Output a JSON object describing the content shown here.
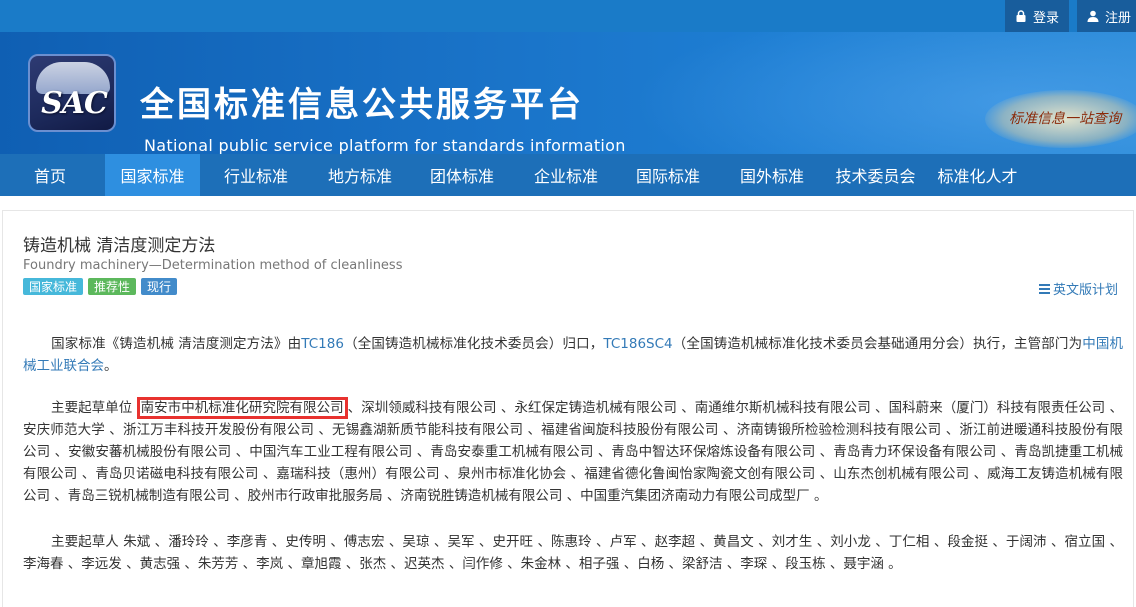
{
  "topbar": {
    "login_label": "登录",
    "register_label": "注册"
  },
  "header": {
    "logo_text": "SAC",
    "title_cn": "全国标准信息公共服务平台",
    "title_en": "National public service platform  for standards information",
    "slogan": "标准信息一站查询"
  },
  "nav": {
    "items": [
      "首页",
      "国家标准",
      "行业标准",
      "地方标准",
      "团体标准",
      "企业标准",
      "国际标准",
      "国外标准",
      "技术委员会",
      "标准化人才"
    ],
    "active": "国家标准"
  },
  "standard": {
    "title": "铸造机械 清洁度测定方法",
    "title_en": "Foundry machinery—Determination method of cleanliness",
    "badges": [
      "国家标准",
      "推荐性",
      "现行"
    ],
    "english_plan_label": "英文版计划"
  },
  "desc": {
    "prefix": "国家标准《铸造机械 清洁度测定方法》由",
    "tc_code": "TC186",
    "tc_name": "（全国铸造机械标准化技术委员会）归口，",
    "sc_code": "TC186SC4",
    "sc_name": "（全国铸造机械标准化技术委员会基础通用分会）执行，主管部门为",
    "dept": "中国机械工业联合会",
    "dept_suffix": "。"
  },
  "drafting_units": {
    "label": "主要起草单位",
    "highlighted": "南安市中机标准化研究院有限公司",
    "rest": "、深圳领威科技有限公司 、永红保定铸造机械有限公司 、南通维尔斯机械科技有限公司 、国科蔚来（厦门）科技有限责任公司 、安庆师范大学 、浙江万丰科技开发股份有限公司 、无锡鑫湖新质节能科技有限公司 、福建省闽旋科技股份有限公司 、济南铸锻所检验检测科技有限公司 、浙江前进暖通科技股份有限公司 、安徽安蕃机械股份有限公司 、中国汽车工业工程有限公司 、青岛安泰重工机械有限公司 、青岛中智达环保熔炼设备有限公司 、青岛青力环保设备有限公司 、青岛凯捷重工机械有限公司 、青岛贝诺磁电科技有限公司 、嘉瑞科技（惠州）有限公司 、泉州市标准化协会 、福建省德化鲁闽怡家陶瓷文创有限公司 、山东杰创机械有限公司 、威海工友铸造机械有限公司 、青岛三锐机械制造有限公司 、胶州市行政审批服务局 、济南锐胜铸造机械有限公司 、中国重汽集团济南动力有限公司成型厂 。"
  },
  "drafters": {
    "label": "主要起草人",
    "names": "朱斌 、潘玲玲 、李彦青 、史传明 、傅志宏 、吴琼 、吴军 、史开旺 、陈惠玲 、卢军 、赵李超 、黄昌文 、刘才生 、刘小龙 、丁仁相 、段金挺 、于阔沛 、宿立国 、李海春 、李远发 、黄志强 、朱芳芳 、李岚 、章旭霞 、张杰 、迟英杰 、闫作修 、朱金林 、相子强 、白杨 、梁舒洁 、李琛 、段玉栋 、聂宇涵 。"
  }
}
